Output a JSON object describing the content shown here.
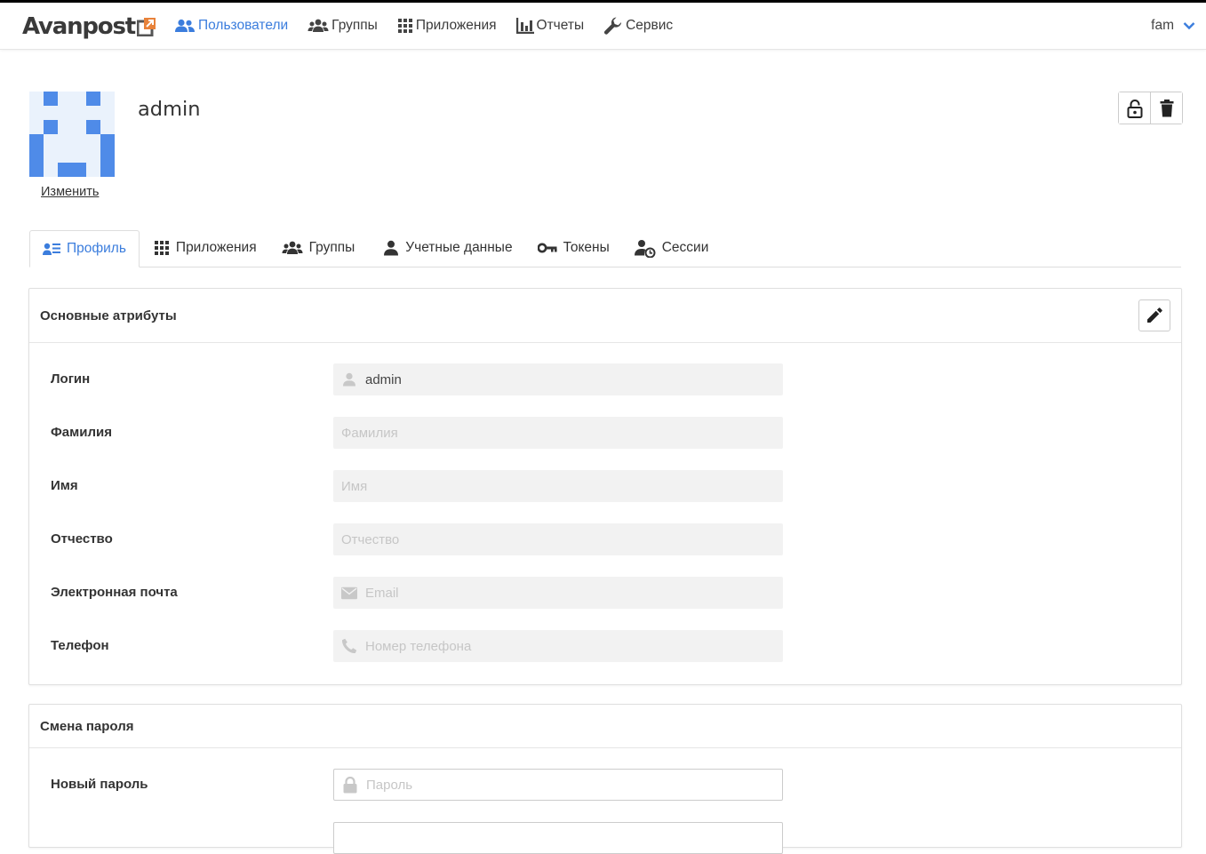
{
  "brand": {
    "name": "Avanpost",
    "accent": "#3b7ddd"
  },
  "nav": {
    "items": [
      {
        "label": "Пользователи",
        "icon": "users-icon",
        "active": true
      },
      {
        "label": "Группы",
        "icon": "group-icon",
        "active": false
      },
      {
        "label": "Приложения",
        "icon": "apps-grid-icon",
        "active": false
      },
      {
        "label": "Отчеты",
        "icon": "bar-chart-icon",
        "active": false
      },
      {
        "label": "Сервис",
        "icon": "wrench-icon",
        "active": false
      }
    ],
    "user": {
      "name": "fam",
      "icon": "chevron-down-icon"
    }
  },
  "profile": {
    "username": "admin",
    "change_avatar_label": "Изменить",
    "actions": [
      {
        "icon": "lock-open-icon"
      },
      {
        "icon": "trash-icon"
      }
    ]
  },
  "tabs": [
    {
      "label": "Профиль",
      "icon": "profile-list-icon",
      "active": true
    },
    {
      "label": "Приложения",
      "icon": "apps-grid-icon",
      "active": false
    },
    {
      "label": "Группы",
      "icon": "group-icon",
      "active": false
    },
    {
      "label": "Учетные данные",
      "icon": "user-icon",
      "active": false
    },
    {
      "label": "Токены",
      "icon": "key-icon",
      "active": false
    },
    {
      "label": "Сессии",
      "icon": "user-clock-icon",
      "active": false
    }
  ],
  "basic_attributes": {
    "title": "Основные атрибуты",
    "edit_icon": "pencil-icon",
    "fields": [
      {
        "label": "Логин",
        "value": "admin",
        "placeholder": "",
        "icon": "user-icon"
      },
      {
        "label": "Фамилия",
        "value": "",
        "placeholder": "Фамилия",
        "icon": ""
      },
      {
        "label": "Имя",
        "value": "",
        "placeholder": "Имя",
        "icon": ""
      },
      {
        "label": "Отчество",
        "value": "",
        "placeholder": "Отчество",
        "icon": ""
      },
      {
        "label": "Электронная почта",
        "value": "",
        "placeholder": "Email",
        "icon": "envelope-icon"
      },
      {
        "label": "Телефон",
        "value": "",
        "placeholder": "Номер телефона",
        "icon": "phone-icon"
      }
    ]
  },
  "password_change": {
    "title": "Смена пароля",
    "fields": [
      {
        "label": "Новый пароль",
        "value": "",
        "placeholder": "Пароль",
        "icon": "lock-icon"
      }
    ]
  }
}
